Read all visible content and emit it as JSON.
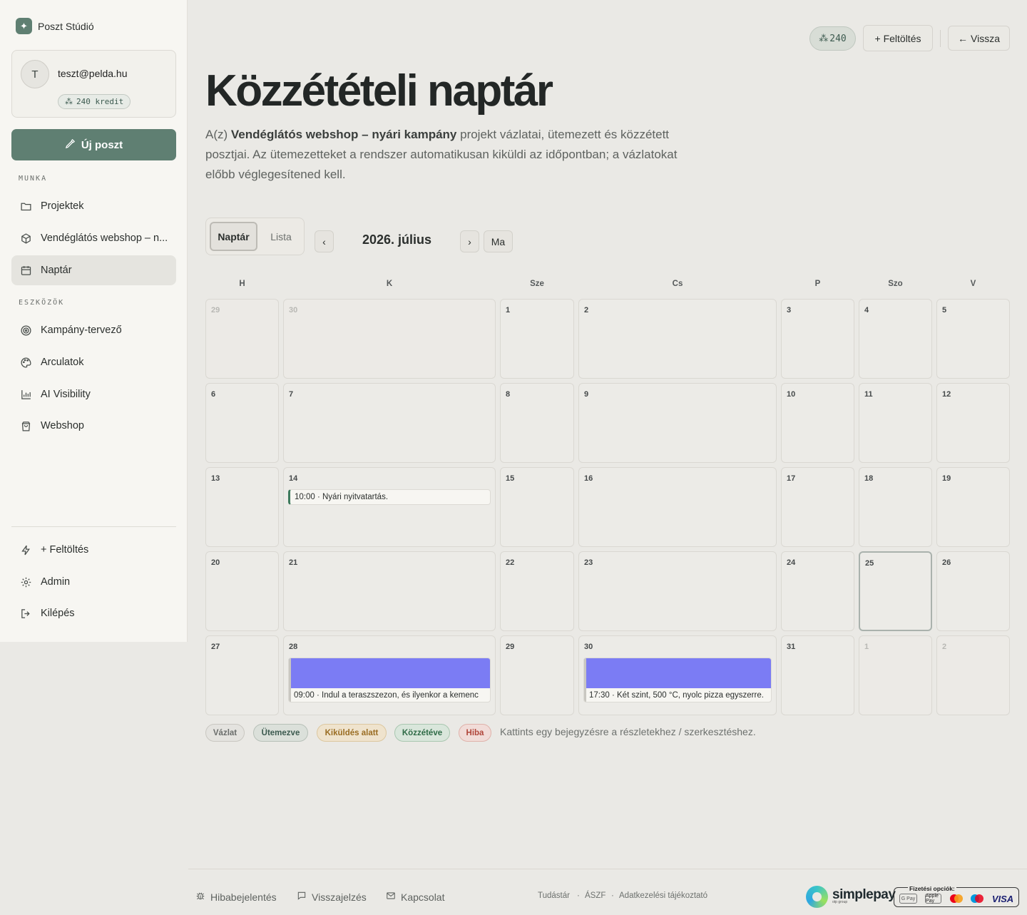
{
  "brand": {
    "name": "Poszt Stúdió",
    "logo_icon": "sparkle-icon"
  },
  "user": {
    "initial": "T",
    "email": "teszt@pelda.hu",
    "credits_label": "240 kredit"
  },
  "sidebar": {
    "new_post_label": "Új poszt",
    "section_work": "MUNKA",
    "section_tools": "ESZKÖZÖK",
    "work_items": [
      {
        "label": "Projektek",
        "icon": "folder-icon"
      },
      {
        "label": "Vendéglátós webshop – n...",
        "icon": "box-icon"
      },
      {
        "label": "Naptár",
        "icon": "calendar-icon",
        "active": true
      }
    ],
    "tool_items": [
      {
        "label": "Kampány-tervező",
        "icon": "target-icon"
      },
      {
        "label": "Arculatok",
        "icon": "palette-icon"
      },
      {
        "label": "AI Visibility",
        "icon": "bar-chart-icon"
      },
      {
        "label": "Webshop",
        "icon": "shopping-bag-icon"
      }
    ],
    "bottom_items": [
      {
        "label": "+ Feltöltés",
        "icon": "lightning-icon"
      },
      {
        "label": "Admin",
        "icon": "gear-icon"
      },
      {
        "label": "Kilépés",
        "icon": "logout-icon"
      }
    ]
  },
  "topbar": {
    "credits": "240",
    "upload_label": "+ Feltöltés",
    "back_label": "Vissza"
  },
  "page": {
    "title": "Közzétételi naptár",
    "desc_prefix": "A(z) ",
    "project_name": "Vendéglátós webshop – nyári kampány",
    "desc_suffix": " projekt vázlatai, ütemezett és közzétett posztjai. Az ütemezetteket a rendszer automatikusan kiküldi az időpontban; a vázlatokat előbb véglegesítened kell."
  },
  "calendar": {
    "view_calendar": "Naptár",
    "view_list": "Lista",
    "prev": "‹",
    "next": "›",
    "today_btn": "Ma",
    "month_label": "2026. július",
    "weekdays": [
      "H",
      "K",
      "Sze",
      "Cs",
      "P",
      "Szo",
      "V"
    ],
    "weeks": [
      [
        {
          "d": "29",
          "o": true
        },
        {
          "d": "30",
          "o": true
        },
        {
          "d": "1"
        },
        {
          "d": "2"
        },
        {
          "d": "3"
        },
        {
          "d": "4"
        },
        {
          "d": "5"
        }
      ],
      [
        {
          "d": "6"
        },
        {
          "d": "7"
        },
        {
          "d": "8"
        },
        {
          "d": "9"
        },
        {
          "d": "10"
        },
        {
          "d": "11"
        },
        {
          "d": "12"
        }
      ],
      [
        {
          "d": "13"
        },
        {
          "d": "14",
          "event": {
            "text": "10:00 · Nyári nyitvatartás."
          }
        },
        {
          "d": "15"
        },
        {
          "d": "16"
        },
        {
          "d": "17"
        },
        {
          "d": "18"
        },
        {
          "d": "19"
        }
      ],
      [
        {
          "d": "20"
        },
        {
          "d": "21"
        },
        {
          "d": "22"
        },
        {
          "d": "23"
        },
        {
          "d": "24"
        },
        {
          "d": "25",
          "today": true
        },
        {
          "d": "26"
        }
      ],
      [
        {
          "d": "27"
        },
        {
          "d": "28",
          "event": {
            "text": "09:00 · Indul a teraszszezon, és ilyenkor a kemenc",
            "image": true
          }
        },
        {
          "d": "29"
        },
        {
          "d": "30",
          "event": {
            "text": "17:30 · Két szint, 500 °C, nyolc pizza egyszerre.",
            "image": true
          }
        },
        {
          "d": "31"
        },
        {
          "d": "1",
          "o": true
        },
        {
          "d": "2",
          "o": true
        }
      ]
    ]
  },
  "legend": {
    "items": [
      {
        "label": "Vázlat",
        "bg": "#e4e3df",
        "border": "#c9c7c1",
        "color": "#6a6d6b"
      },
      {
        "label": "Ütemezve",
        "bg": "#dbe0da",
        "border": "#b7c0b8",
        "color": "#3c5a4f"
      },
      {
        "label": "Kiküldés alatt",
        "bg": "#efe3cd",
        "border": "#dcc79f",
        "color": "#9a6d23"
      },
      {
        "label": "Közzétéve",
        "bg": "#d9e6db",
        "border": "#a9c7b0",
        "color": "#2f6b47"
      },
      {
        "label": "Hiba",
        "bg": "#f1dcd8",
        "border": "#dfb2aa",
        "color": "#b0463a"
      }
    ],
    "hint": "Kattints egy bejegyzésre a részletekhez / szerkesztéshez."
  },
  "footer": {
    "bug_report": "Hibabejelentés",
    "feedback": "Visszajelzés",
    "contact": "Kapcsolat",
    "links": [
      "Tudástár",
      "ÁSZF",
      "Adatkezelési tájékoztató"
    ],
    "separator": "·",
    "payment_brand": "simplepay",
    "payment_brand_sub": "otp group",
    "payment_options_label": "Fizetési opciók:",
    "payment_methods": [
      "G Pay",
      "Apple Pay",
      "Mastercard",
      "Maestro",
      "VISA"
    ]
  }
}
